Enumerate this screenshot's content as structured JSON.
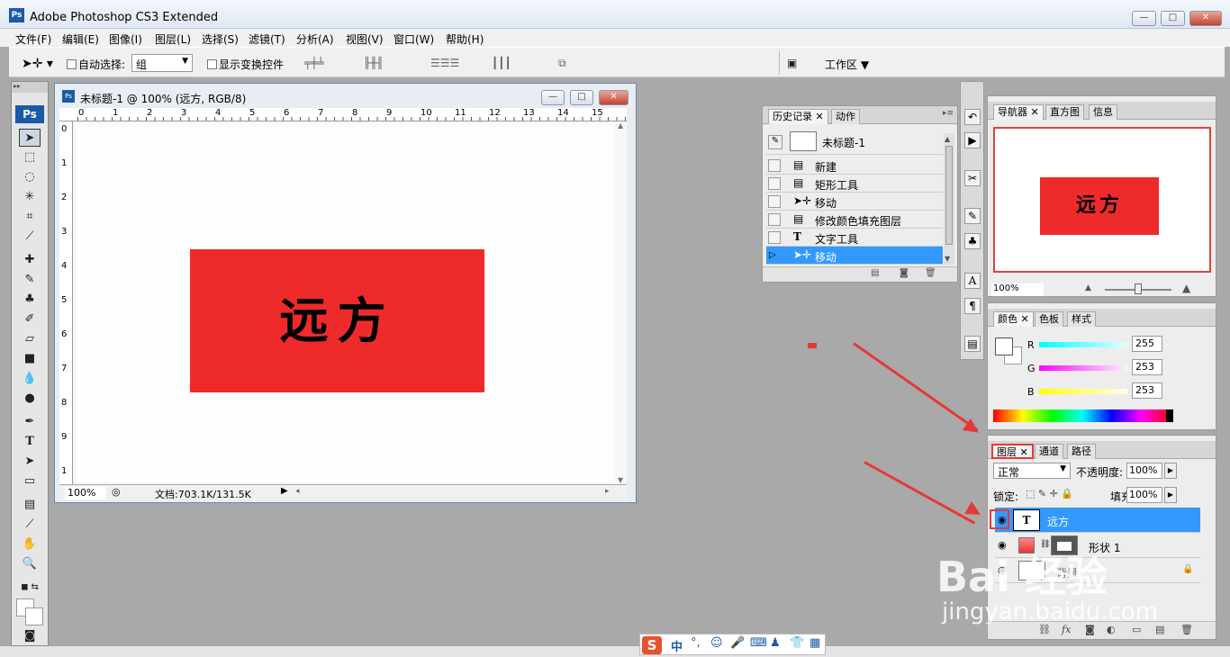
{
  "app": {
    "title": "Adobe Photoshop CS3 Extended",
    "logo": "Ps"
  },
  "window_controls": {
    "minimize": "—",
    "maximize": "□",
    "close": "✕"
  },
  "menu": [
    "文件(F)",
    "编辑(E)",
    "图像(I)",
    "图层(L)",
    "选择(S)",
    "滤镜(T)",
    "分析(A)",
    "视图(V)",
    "窗口(W)",
    "帮助(H)"
  ],
  "options_bar": {
    "auto_select_label": "自动选择:",
    "auto_select_value": "组",
    "transform_label": "显示变换控件",
    "workspace_label": "工作区"
  },
  "document": {
    "title": "未标题-1 @ 100% (远方, RGB/8)",
    "canvas_text": "远方",
    "ruler_top": [
      "0",
      "1",
      "2",
      "3",
      "4",
      "5",
      "6",
      "7",
      "8",
      "9",
      "10",
      "11",
      "12",
      "13",
      "14",
      "15"
    ],
    "ruler_left": [
      "0",
      "1",
      "2",
      "3",
      "4",
      "5",
      "6",
      "7",
      "8",
      "9",
      "1"
    ],
    "zoom": "100%",
    "doc_size": "文档:703.1K/131.5K"
  },
  "history_panel": {
    "tabs": [
      "历史记录",
      "动作"
    ],
    "snapshot": "未标题-1",
    "items": [
      {
        "label": "新建",
        "icon": "document-icon"
      },
      {
        "label": "矩形工具",
        "icon": "document-icon"
      },
      {
        "label": "移动",
        "icon": "move-icon"
      },
      {
        "label": "修改颜色填充图层",
        "icon": "document-icon"
      },
      {
        "label": "文字工具",
        "icon": "type-icon"
      },
      {
        "label": "移动",
        "icon": "move-icon",
        "selected": true
      }
    ]
  },
  "navigator_panel": {
    "tabs": [
      "导航器",
      "直方图",
      "信息"
    ],
    "preview_text": "远方",
    "zoom": "100%"
  },
  "color_panel": {
    "tabs": [
      "颜色",
      "色板",
      "样式"
    ],
    "channels": [
      {
        "label": "R",
        "value": "255",
        "color": "#00e5e5"
      },
      {
        "label": "G",
        "value": "253",
        "color": "#e000e0"
      },
      {
        "label": "B",
        "value": "253",
        "color": "#e6e600"
      }
    ]
  },
  "layers_panel": {
    "tabs": [
      "图层",
      "通道",
      "路径"
    ],
    "blend_mode": "正常",
    "opacity_label": "不透明度:",
    "opacity_value": "100%",
    "lock_label": "锁定:",
    "fill_label": "填充:",
    "fill_value": "100%",
    "layers": [
      {
        "name": "远方",
        "thumb": "T",
        "selected": true
      },
      {
        "name": "形状 1",
        "thumb": ""
      },
      {
        "name": "背景",
        "thumb": ""
      }
    ]
  },
  "ime": {
    "label": "中",
    "logo": "S"
  },
  "watermark": {
    "line1": "Bai 经验",
    "line2": "jingyan.baidu.com"
  },
  "colors": {
    "accent": "#3399ff",
    "shape_fill": "#ef2a2b",
    "annotation": "#e53935"
  }
}
